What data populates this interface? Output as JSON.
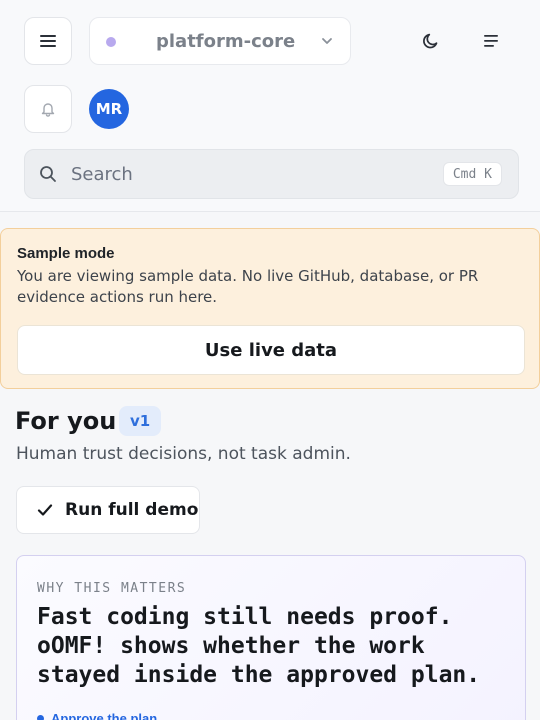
{
  "header": {
    "workspace_name": "platform-core",
    "avatar_initials": "MR",
    "menu_icon": "hamburger-icon",
    "theme_icon": "moon-icon",
    "notifications_icon": "bell-icon",
    "sidebar_icon": "lines-icon"
  },
  "search": {
    "placeholder": "Search",
    "shortcut": "Cmd K"
  },
  "banner": {
    "title": "Sample mode",
    "text": "You are viewing sample data. No live GitHub, database, or PR evidence actions run here.",
    "button_label": "Use live data"
  },
  "main": {
    "title": "For you",
    "version_badge": "v1",
    "subtitle": "Human trust decisions, not task admin.",
    "demo_button_label": "Run full demo"
  },
  "card": {
    "eyebrow": "WHY THIS MATTERS",
    "title": "Fast coding still needs proof. oOMF! shows whether the work stayed inside the approved plan.",
    "link_label": "Approve the plan"
  },
  "colors": {
    "accent": "#2466e0",
    "banner_bg": "#fdf0dd",
    "banner_border": "#f3cf9b",
    "workspace_dot": "#b8a9ee"
  }
}
